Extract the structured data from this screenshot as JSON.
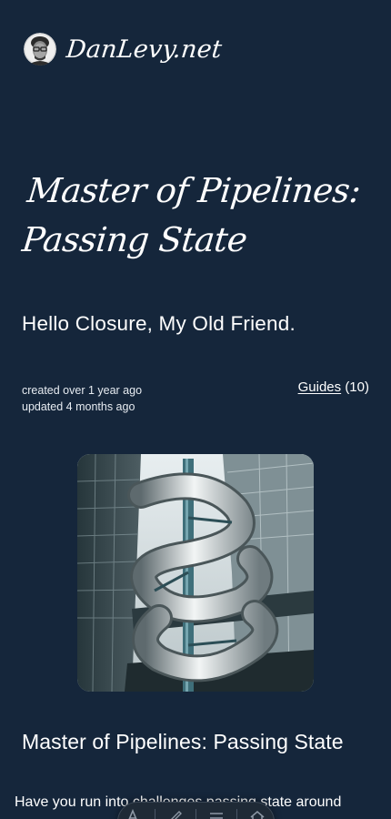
{
  "site": {
    "title": "DanLevy.net"
  },
  "post": {
    "title": "Master of Pipelines: Passing State",
    "subtitle": "Hello Closure, My Old Friend.",
    "created": "created over 1 year ago",
    "updated": "updated 4 months ago",
    "category_label": "Guides",
    "category_count": "(10)",
    "section_title": "Master of Pipelines: Passing State",
    "intro": "Have you run into challenges passing state around"
  },
  "toolbar": {
    "icons": [
      "text-size-icon",
      "brush-icon",
      "menu-icon",
      "home-icon"
    ]
  },
  "colors": {
    "background": "#15263b",
    "text": "#ffffff",
    "toolbar": "#1f2a36"
  }
}
